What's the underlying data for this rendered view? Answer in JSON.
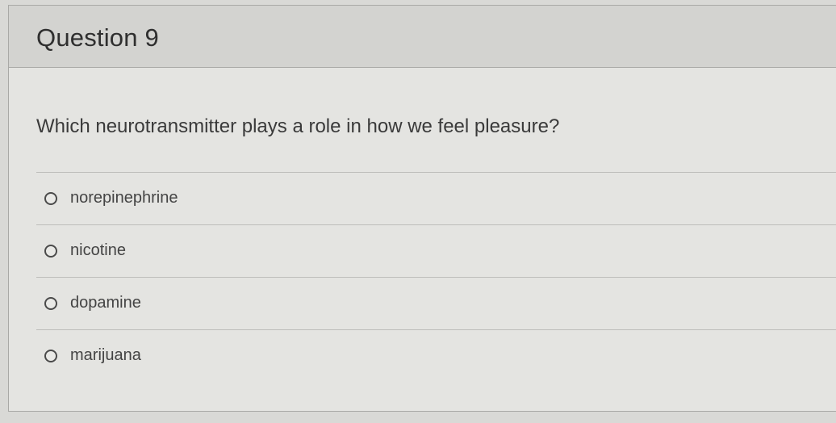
{
  "question": {
    "title": "Question 9",
    "text": "Which neurotransmitter plays a role in how we feel pleasure?",
    "answers": [
      {
        "label": "norepinephrine",
        "selected": false
      },
      {
        "label": "nicotine",
        "selected": false
      },
      {
        "label": "dopamine",
        "selected": false
      },
      {
        "label": "marijuana",
        "selected": false
      }
    ]
  }
}
